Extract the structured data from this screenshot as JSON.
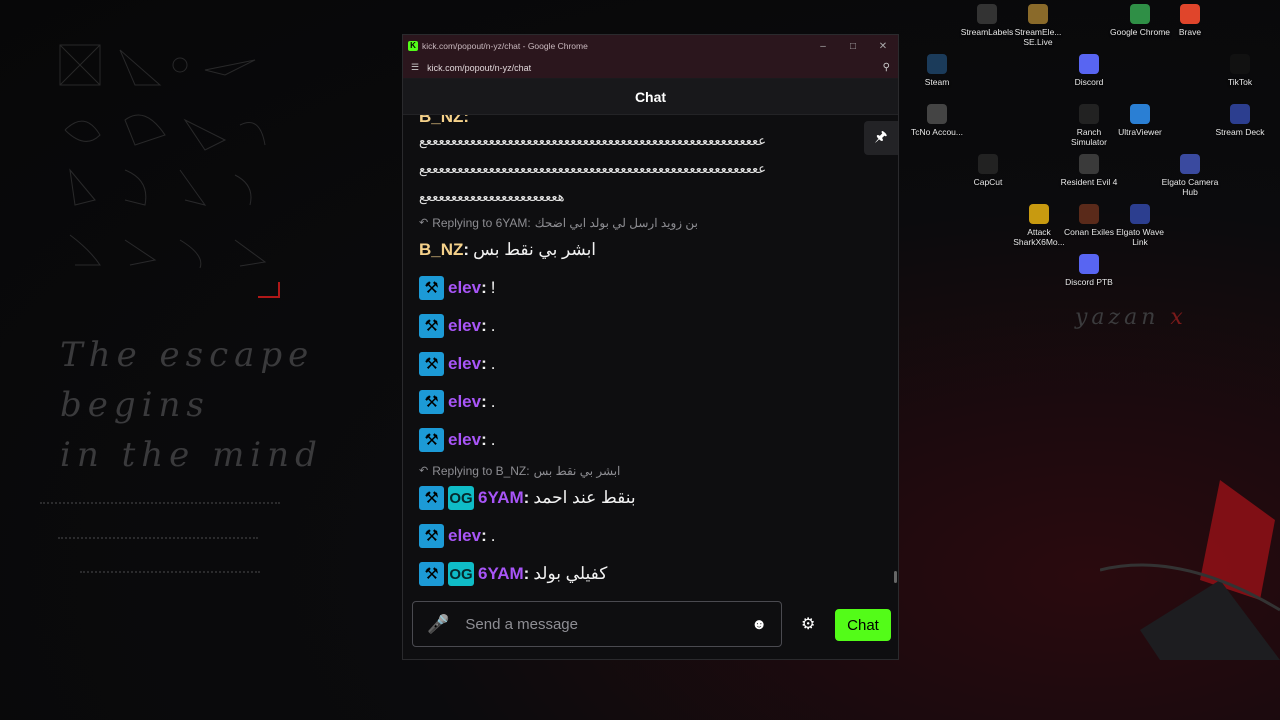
{
  "browser": {
    "window_title": "kick.com/popout/n-yz/chat - Google Chrome",
    "url": "kick.com/popout/n-yz/chat",
    "favicon_letter": "K"
  },
  "chat": {
    "header_title": "Chat",
    "top_partial_user": "B_NZ:",
    "spam_lines": [
      "ععععععععععععععععععععععععععععععععععععععععععععععععععععععع",
      "ععععععععععععععععععععععععععععععععععععععععععععععععععععععع",
      "هعععععععععععععععععععععع"
    ],
    "messages": [
      {
        "reply": {
          "prefix": "Replying to 6YAM:",
          "text": "بن زويد ارسل لي بولد ابي اضحك"
        },
        "user": "B_NZ",
        "color": "#f5d18a",
        "badges": [],
        "text": "ابشر بي نقط بس"
      },
      {
        "user": "elev",
        "color": "#a855f7",
        "badges": [
          "mod"
        ],
        "text": "!"
      },
      {
        "user": "elev",
        "color": "#a855f7",
        "badges": [
          "mod"
        ],
        "text": "."
      },
      {
        "user": "elev",
        "color": "#a855f7",
        "badges": [
          "mod"
        ],
        "text": "."
      },
      {
        "user": "elev",
        "color": "#a855f7",
        "badges": [
          "mod"
        ],
        "text": "."
      },
      {
        "user": "elev",
        "color": "#a855f7",
        "badges": [
          "mod"
        ],
        "text": "."
      },
      {
        "reply": {
          "prefix": "Replying to B_NZ:",
          "text": "ابشر بي نقط بس"
        },
        "user": "6YAM",
        "color": "#a855f7",
        "badges": [
          "mod",
          "og"
        ],
        "text": "بنقط عند احمد"
      },
      {
        "user": "elev",
        "color": "#a855f7",
        "badges": [
          "mod"
        ],
        "text": "."
      },
      {
        "user": "6YAM",
        "color": "#a855f7",
        "badges": [
          "mod",
          "og"
        ],
        "text": "كفيلي بولد"
      }
    ],
    "input_placeholder": "Send a message",
    "send_label": "Chat"
  },
  "wallpaper": {
    "quote_lines": [
      "The escape",
      "begins",
      "in the mind"
    ],
    "signature_main": "yazan",
    "signature_mark": "x"
  },
  "desktop_icons": [
    {
      "label": "StreamLabels",
      "icon": "streamlabels-icon",
      "color": "#333333"
    },
    {
      "label": "StreamEle... SE.Live",
      "icon": "streamelements-icon",
      "color": "#8a6a2a"
    },
    {
      "label": "Google Chrome",
      "icon": "chrome-icon",
      "color": "#2f8f46"
    },
    {
      "label": "Brave",
      "icon": "brave-icon",
      "color": "#e0452b"
    },
    {
      "label": "Steam",
      "icon": "steam-icon",
      "color": "#1b3b5a"
    },
    {
      "label": "Discord",
      "icon": "discord-icon",
      "color": "#5865f2"
    },
    {
      "label": "TikTok",
      "icon": "tiktok-icon",
      "color": "#111111"
    },
    {
      "label": "TcNo Accou...",
      "icon": "tcno-icon",
      "color": "#444444"
    },
    {
      "label": "Ranch Simulator",
      "icon": "ranch-icon",
      "color": "#222222"
    },
    {
      "label": "UltraViewer",
      "icon": "ultraviewer-icon",
      "color": "#2a7fd4"
    },
    {
      "label": "Stream Deck",
      "icon": "streamdeck-icon",
      "color": "#2c3e8f"
    },
    {
      "label": "CapCut",
      "icon": "capcut-icon",
      "color": "#222222"
    },
    {
      "label": "Resident Evil 4",
      "icon": "re4-icon",
      "color": "#3a3a3a"
    },
    {
      "label": "Elgato Camera Hub",
      "icon": "camerahub-icon",
      "color": "#3a4a9f"
    },
    {
      "label": "Attack SharkX6Mo...",
      "icon": "attackshark-icon",
      "color": "#c89a10"
    },
    {
      "label": "Conan Exiles",
      "icon": "conan-icon",
      "color": "#5a2a1a"
    },
    {
      "label": "Elgato Wave Link",
      "icon": "wavelink-icon",
      "color": "#2c3e8f"
    },
    {
      "label": "Discord PTB",
      "icon": "discord-ptb-icon",
      "color": "#5865f2"
    }
  ]
}
